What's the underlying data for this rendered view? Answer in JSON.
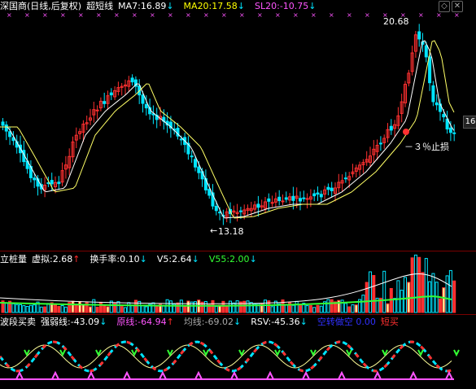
{
  "top_panel": {
    "stock_name": "深国商(日线,后复权)",
    "indicator_name": "超短线",
    "ma7": {
      "label": "MA7:",
      "value": "16.89",
      "color": "#ffffff"
    },
    "ma20": {
      "label": "MA20:",
      "value": "17.58",
      "color": "#ffff00"
    },
    "sl20": {
      "label": "SL20:",
      "value": "-10.75",
      "color": "#ff55ff"
    },
    "high_label": "20.68",
    "low_label": "13.18",
    "stop_label": "－３％止损",
    "side_value": "16",
    "controls": [
      "◇",
      "✕"
    ]
  },
  "volume_panel": {
    "title": "立桩量",
    "virtual": {
      "label": "虚拟:",
      "value": "2.68"
    },
    "turnover": {
      "label": "换手率:",
      "value": "0.10"
    },
    "v5": {
      "label": "V5:",
      "value": "2.64"
    },
    "v55": {
      "label": "V55:",
      "value": "2.00"
    }
  },
  "indicator_panel": {
    "title": "波段买卖",
    "strength": {
      "label": "强弱线:",
      "value": "-43.09"
    },
    "origin": {
      "label": "原线:",
      "value": "-64.94"
    },
    "avg": {
      "label": "均线:",
      "value": "-69.02"
    },
    "rsv": {
      "label": "RSV:",
      "value": "-45.36"
    },
    "dark_label": "空转做空",
    "dark_value": "0.00",
    "short_sell": "短买"
  },
  "colors": {
    "up": "#ff3030",
    "down": "#00e5ff",
    "ma_white": "#ffffff",
    "ma_yellow": "#ffff66",
    "magenta": "#ff55ff",
    "green": "#33ff33"
  }
}
